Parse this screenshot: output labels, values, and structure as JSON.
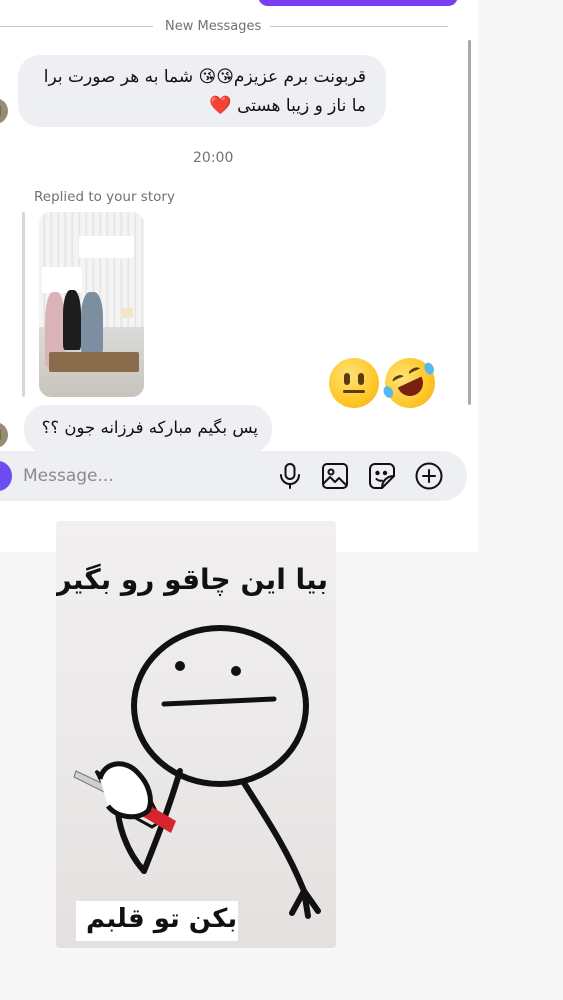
{
  "divider": {
    "label": "New Messages"
  },
  "messages": {
    "first": {
      "line1": "قربونت برم عزیزم😘😘 شما به هر صورت برا",
      "line2": "ما ناز و زیبا هستی",
      "heart": "❤️"
    },
    "timestamp": "20:00",
    "story_reply": {
      "label": "Replied to your story",
      "reactions": [
        "😐",
        "🤣"
      ]
    },
    "second": {
      "text": "پس بگیم مبارکه فرزانه جون ؟؟"
    }
  },
  "composer": {
    "placeholder": "Message...",
    "icons": [
      "microphone-icon",
      "image-icon",
      "sticker-icon",
      "add-icon"
    ]
  },
  "meme": {
    "caption_top": "بیا این چاقو رو بگیر",
    "caption_bottom": "بکن تو قلبم"
  },
  "colors": {
    "accent": "#7b3ff2",
    "bubble": "#eeeff2",
    "muted_text": "#707075"
  }
}
